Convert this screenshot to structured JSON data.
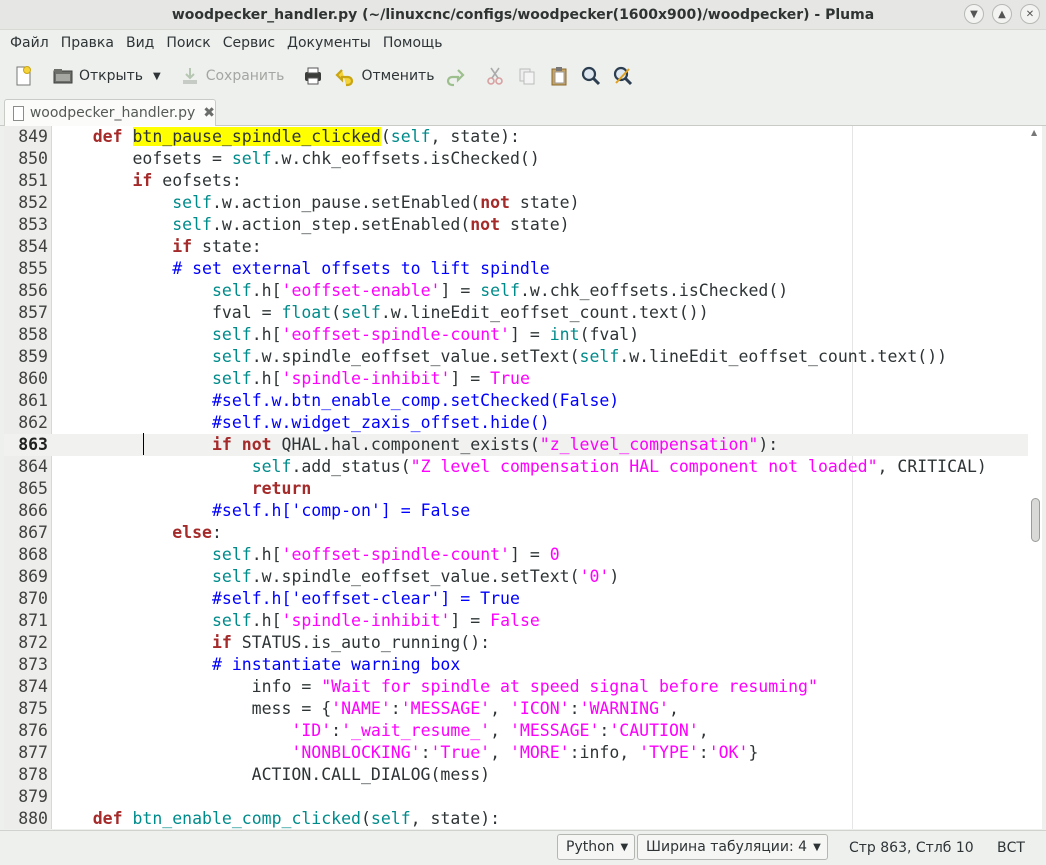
{
  "window": {
    "title": "woodpecker_handler.py (~/linuxcnc/configs/woodpecker(1600x900)/woodpecker) - Pluma"
  },
  "menu": [
    "Файл",
    "Правка",
    "Вид",
    "Поиск",
    "Сервис",
    "Документы",
    "Помощь"
  ],
  "toolbar": {
    "open_label": "Открыть",
    "save_label": "Сохранить",
    "undo_label": "Отменить"
  },
  "tab": {
    "label": "woodpecker_handler.py",
    "close": "✖"
  },
  "editor": {
    "current_line": "863",
    "lines": [
      {
        "n": "849",
        "t": "    def btn_pause_spindle_clicked(self, state):"
      },
      {
        "n": "850",
        "t": "        eofsets = self.w.chk_eoffsets.isChecked()"
      },
      {
        "n": "851",
        "t": "        if eofsets:"
      },
      {
        "n": "852",
        "t": "            self.w.action_pause.setEnabled(not state)"
      },
      {
        "n": "853",
        "t": "            self.w.action_step.setEnabled(not state)"
      },
      {
        "n": "854",
        "t": "            if state:"
      },
      {
        "n": "855",
        "t": "            # set external offsets to lift spindle"
      },
      {
        "n": "856",
        "t": "                self.h['eoffset-enable'] = self.w.chk_eoffsets.isChecked()"
      },
      {
        "n": "857",
        "t": "                fval = float(self.w.lineEdit_eoffset_count.text())"
      },
      {
        "n": "858",
        "t": "                self.h['eoffset-spindle-count'] = int(fval)"
      },
      {
        "n": "859",
        "t": "                self.w.spindle_eoffset_value.setText(self.w.lineEdit_eoffset_count.text())"
      },
      {
        "n": "860",
        "t": "                self.h['spindle-inhibit'] = True"
      },
      {
        "n": "861",
        "t": "                #self.w.btn_enable_comp.setChecked(False)"
      },
      {
        "n": "862",
        "t": "                #self.w.widget_zaxis_offset.hide()"
      },
      {
        "n": "863",
        "t": "                if not QHAL.hal.component_exists(\"z_level_compensation\"):"
      },
      {
        "n": "864",
        "t": "                    self.add_status(\"Z level compensation HAL component not loaded\", CRITICAL)"
      },
      {
        "n": "865",
        "t": "                    return"
      },
      {
        "n": "866",
        "t": "                #self.h['comp-on'] = False"
      },
      {
        "n": "867",
        "t": "            else:"
      },
      {
        "n": "868",
        "t": "                self.h['eoffset-spindle-count'] = 0"
      },
      {
        "n": "869",
        "t": "                self.w.spindle_eoffset_value.setText('0')"
      },
      {
        "n": "870",
        "t": "                #self.h['eoffset-clear'] = True"
      },
      {
        "n": "871",
        "t": "                self.h['spindle-inhibit'] = False"
      },
      {
        "n": "872",
        "t": "                if STATUS.is_auto_running():"
      },
      {
        "n": "873",
        "t": "                # instantiate warning box"
      },
      {
        "n": "874",
        "t": "                    info = \"Wait for spindle at speed signal before resuming\""
      },
      {
        "n": "875",
        "t": "                    mess = {'NAME':'MESSAGE', 'ICON':'WARNING',"
      },
      {
        "n": "876",
        "t": "                        'ID':'_wait_resume_', 'MESSAGE':'CAUTION',"
      },
      {
        "n": "877",
        "t": "                        'NONBLOCKING':'True', 'MORE':info, 'TYPE':'OK'}"
      },
      {
        "n": "878",
        "t": "                    ACTION.CALL_DIALOG(mess)"
      },
      {
        "n": "879",
        "t": ""
      },
      {
        "n": "880",
        "t": "    def btn_enable_comp_clicked(self, state):"
      }
    ],
    "highlight_word": "btn_pause_spindle_clicked"
  },
  "statusbar": {
    "language": "Python",
    "tab_width": "Ширина табуляции: 4",
    "position": "Стр 863, Стлб 10",
    "mode": "ВСТ"
  },
  "colors": {
    "keyword": "#a52a2a",
    "self": "#008b8b",
    "string": "#ff00ff",
    "comment": "#0000ff",
    "search_highlight": "#ffff00"
  }
}
